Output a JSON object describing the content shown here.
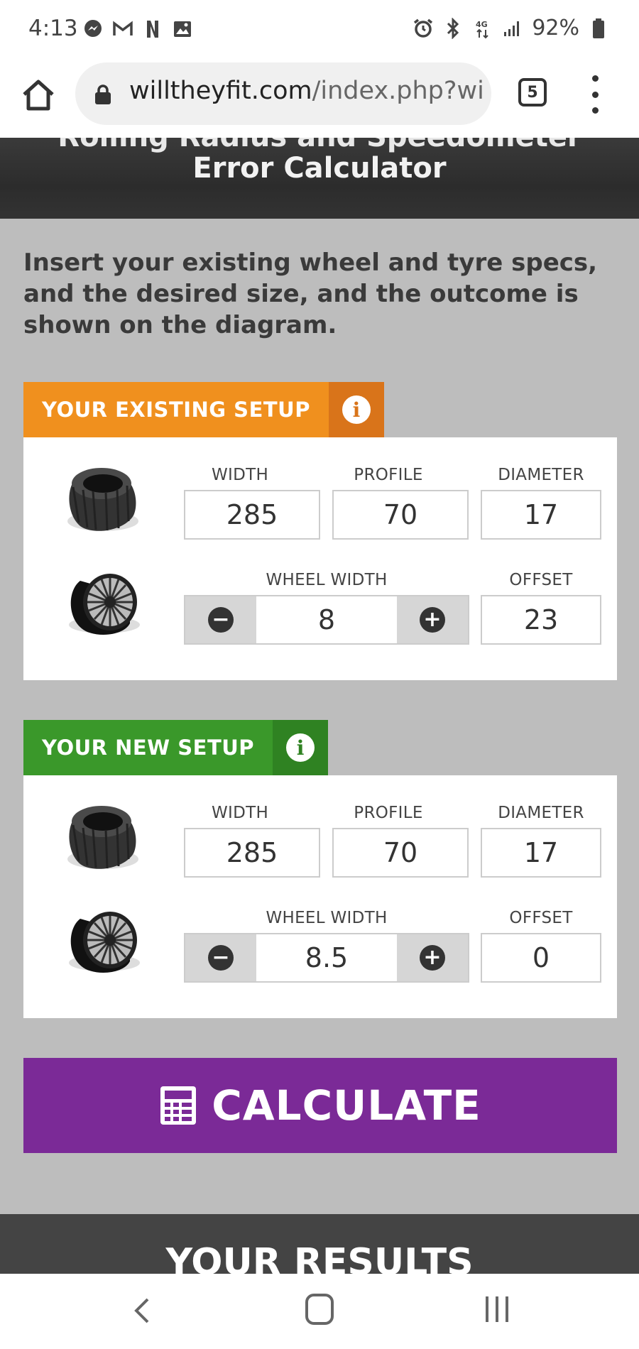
{
  "status_bar": {
    "time": "4:13",
    "left_icons": [
      "messenger-icon",
      "gmail-icon",
      "netflix-icon",
      "gallery-icon"
    ],
    "right_icons": [
      "alarm-icon",
      "bluetooth-icon",
      "data-4g-icon",
      "signal-icon"
    ],
    "battery": "92%"
  },
  "browser": {
    "url_domain": "willtheyfit.com",
    "url_path": "/index.php?wi",
    "tab_count": "5"
  },
  "hero": {
    "title_line1": "Rolling Radius and Speedometer",
    "title_line2": "Error Calculator"
  },
  "intro_text": "Insert your existing wheel and tyre specs, and the desired size, and the outcome is shown on the diagram.",
  "existing_setup": {
    "header": "YOUR EXISTING SETUP",
    "color": "#f0901e",
    "info_color": "#d9741a",
    "labels": {
      "width": "WIDTH",
      "profile": "PROFILE",
      "diameter": "DIAMETER",
      "wheel_width": "WHEEL WIDTH",
      "offset": "OFFSET"
    },
    "width": "285",
    "profile": "70",
    "diameter": "17",
    "wheel_width": "8",
    "offset": "23"
  },
  "new_setup": {
    "header": "YOUR NEW SETUP",
    "color": "#3a982a",
    "info_color": "#2f8222",
    "labels": {
      "width": "WIDTH",
      "profile": "PROFILE",
      "diameter": "DIAMETER",
      "wheel_width": "WHEEL WIDTH",
      "offset": "OFFSET"
    },
    "width": "285",
    "profile": "70",
    "diameter": "17",
    "wheel_width": "8.5",
    "offset": "0"
  },
  "calculate_label": "CALCULATE",
  "results_title": "YOUR RESULTS"
}
